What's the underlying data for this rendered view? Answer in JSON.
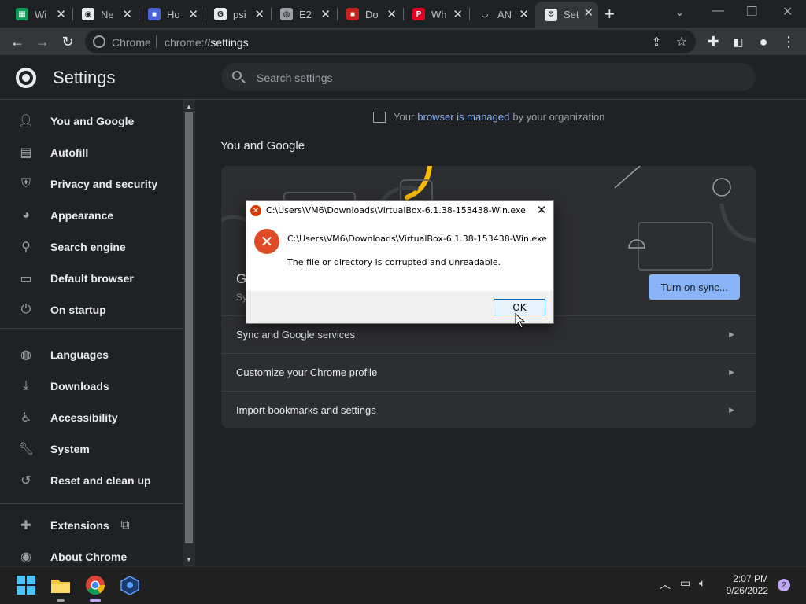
{
  "window": {
    "tabs": [
      {
        "title": "Wi",
        "favicon": "sheets-icon",
        "favicon_color": "#0f9d58",
        "active": false
      },
      {
        "title": "Ne",
        "favicon": "chrome-icon",
        "favicon_color": "#e8eaed",
        "active": false
      },
      {
        "title": "Ho",
        "favicon": "site-icon",
        "favicon_color": "#4a64d8",
        "active": false
      },
      {
        "title": "psi",
        "favicon": "google-icon",
        "favicon_color": "#e8eaed",
        "active": false
      },
      {
        "title": "E2",
        "favicon": "globe-icon",
        "favicon_color": "#9aa0a6",
        "active": false
      },
      {
        "title": "Do",
        "favicon": "site-icon",
        "favicon_color": "#c5221f",
        "active": false
      },
      {
        "title": "Wh",
        "favicon": "pinterest-icon",
        "favicon_color": "#e60023",
        "active": false
      },
      {
        "title": "AN",
        "favicon": "smile-icon",
        "favicon_color": "#202124",
        "active": false
      },
      {
        "title": "Sett",
        "favicon": "gear-icon",
        "favicon_color": "#e8eaed",
        "active": true
      }
    ],
    "new_tab": "+"
  },
  "toolbar": {
    "omnibox_label": "Chrome",
    "url_scheme": "chrome://",
    "url_path": "settings"
  },
  "settings": {
    "title": "Settings",
    "search_placeholder": "Search settings",
    "sidebar": {
      "group1": [
        {
          "label": "You and Google",
          "icon": "person-icon"
        },
        {
          "label": "Autofill",
          "icon": "clipboard-icon"
        },
        {
          "label": "Privacy and security",
          "icon": "shield-icon"
        },
        {
          "label": "Appearance",
          "icon": "palette-icon"
        },
        {
          "label": "Search engine",
          "icon": "search-icon"
        },
        {
          "label": "Default browser",
          "icon": "browser-icon"
        },
        {
          "label": "On startup",
          "icon": "power-icon"
        }
      ],
      "group2": [
        {
          "label": "Languages",
          "icon": "globe-icon"
        },
        {
          "label": "Downloads",
          "icon": "download-icon"
        },
        {
          "label": "Accessibility",
          "icon": "accessibility-icon"
        },
        {
          "label": "System",
          "icon": "wrench-icon"
        },
        {
          "label": "Reset and clean up",
          "icon": "history-icon"
        }
      ],
      "group3": [
        {
          "label": "Extensions",
          "icon": "puzzle-icon"
        },
        {
          "label": "About Chrome",
          "icon": "chrome-icon"
        }
      ]
    },
    "managed": {
      "prefix": "Your",
      "link": "browser is managed",
      "suffix": "by your organization"
    },
    "section_title": "You and Google",
    "sync_peek_title": "G",
    "sync_peek_sub": "Sy",
    "sync_button": "Turn on sync...",
    "rows": [
      "Sync and Google services",
      "Customize your Chrome profile",
      "Import bookmarks and settings"
    ]
  },
  "dialog": {
    "title": "C:\\Users\\VM6\\Downloads\\VirtualBox-6.1.38-153438-Win.exe",
    "path": "C:\\Users\\VM6\\Downloads\\VirtualBox-6.1.38-153438-Win.exe",
    "message": "The file or directory is corrupted and unreadable.",
    "ok_label": "OK",
    "icon": "error-icon"
  },
  "taskbar": {
    "time": "2:07 PM",
    "date": "9/26/2022",
    "notification_count": "2"
  },
  "colors": {
    "accent": "#8ab4f8",
    "background": "#202124",
    "error": "#e04b27"
  }
}
